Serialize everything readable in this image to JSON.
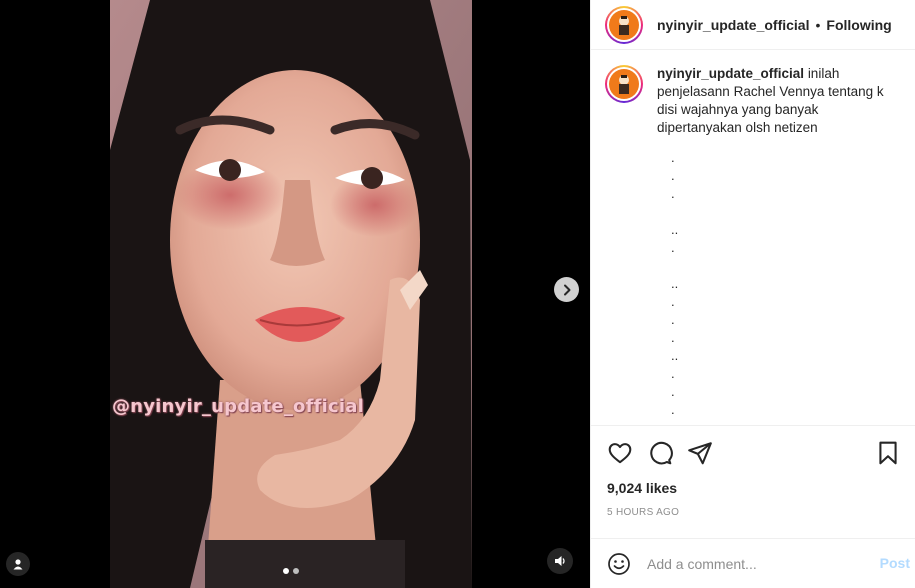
{
  "post": {
    "username": "nyinyir_update_official",
    "separator": "•",
    "follow_status": "Following",
    "watermark": "@nyinyir_update_official",
    "carousel": {
      "slides": 2,
      "active_index": 0
    }
  },
  "caption": {
    "username": "nyinyir_update_official",
    "text": "inilah penjelasann Rachel Vennya tentang k disi wajahnya yang banyak dipertanyakan olsh netizen",
    "dot_lines": [
      ".",
      ".",
      ".",
      "",
      "..",
      ".",
      "",
      "..",
      ".",
      ".",
      ".",
      "..",
      ".",
      ".",
      "."
    ]
  },
  "stats": {
    "likes": "9,024 likes",
    "timestamp": "5 HOURS AGO"
  },
  "comment": {
    "placeholder": "Add a comment...",
    "post_label": "Post"
  },
  "icons": {
    "next": "chevron-right-icon",
    "tag": "user-icon",
    "audio": "speaker-icon",
    "like": "heart-icon",
    "comment": "comment-icon",
    "share": "send-icon",
    "save": "bookmark-icon",
    "emoji": "smiley-icon"
  },
  "colors": {
    "avatar_bg": "#f07a1a",
    "post_button_disabled": "#b3dbff",
    "muted_text": "#8e8e8e",
    "watermark": "#f6c7cf"
  }
}
